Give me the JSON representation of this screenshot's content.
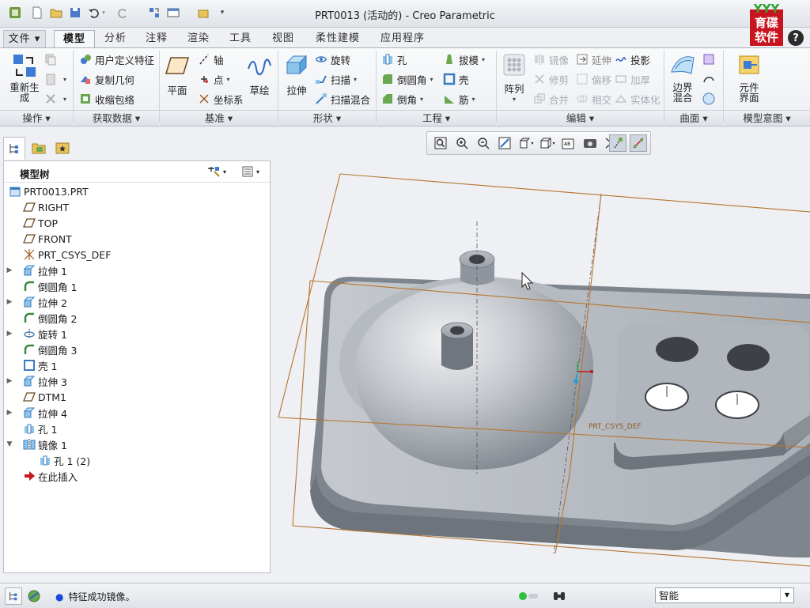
{
  "window": {
    "title": "PRT0013 (活动的) - Creo Parametric",
    "brand_top": "YYY",
    "brand_text": "育碟\n软件"
  },
  "tabs": [
    "文件 ▾",
    "模型",
    "分析",
    "注释",
    "渲染",
    "工具",
    "视图",
    "柔性建模",
    "应用程序"
  ],
  "ribbon": {
    "operations": {
      "regen": "重新生成",
      "group": "操作"
    },
    "get_data": {
      "udf": "用户定义特征",
      "copy_geom": "复制几何",
      "shrinkwrap": "收缩包络",
      "group": "获取数据"
    },
    "datum": {
      "plane": "平面",
      "axis": "轴",
      "point": "点",
      "csys": "坐标系",
      "sketch": "草绘",
      "group": "基准"
    },
    "shapes": {
      "extrude": "拉伸",
      "revolve": "旋转",
      "sweep": "扫描",
      "swept_blend": "扫描混合",
      "group": "形状"
    },
    "engineering": {
      "hole": "孔",
      "round": "倒圆角",
      "chamfer": "倒角",
      "draft": "拔模",
      "shell": "壳",
      "rib": "筋",
      "group": "工程"
    },
    "editing": {
      "pattern": "阵列",
      "mirror": "镜像",
      "trim": "修剪",
      "merge": "合并",
      "extend": "延伸",
      "offset": "偏移",
      "intersect": "相交",
      "project": "投影",
      "thicken": "加厚",
      "solidify": "实体化",
      "group": "编辑"
    },
    "surfaces": {
      "boundary_blend": "边界混合",
      "group": "曲面"
    },
    "model_intent": {
      "component_interface": "元件界面",
      "group": "模型意图"
    }
  },
  "model_tree": {
    "title": "模型树",
    "items": [
      {
        "label": "PRT0013.PRT",
        "icon": "part-icon"
      },
      {
        "label": "RIGHT",
        "icon": "datum-plane-icon"
      },
      {
        "label": "TOP",
        "icon": "datum-plane-icon"
      },
      {
        "label": "FRONT",
        "icon": "datum-plane-icon"
      },
      {
        "label": "PRT_CSYS_DEF",
        "icon": "csys-icon"
      },
      {
        "label": "拉伸 1",
        "icon": "extrude-icon"
      },
      {
        "label": "倒圆角 1",
        "icon": "round-icon"
      },
      {
        "label": "拉伸 2",
        "icon": "extrude-icon"
      },
      {
        "label": "倒圆角 2",
        "icon": "round-icon"
      },
      {
        "label": "旋转 1",
        "icon": "revolve-icon"
      },
      {
        "label": "倒圆角 3",
        "icon": "round-icon"
      },
      {
        "label": "壳 1",
        "icon": "shell-icon"
      },
      {
        "label": "拉伸 3",
        "icon": "extrude-icon"
      },
      {
        "label": "DTM1",
        "icon": "datum-plane-icon"
      },
      {
        "label": "拉伸 4",
        "icon": "extrude-icon"
      },
      {
        "label": "孔 1",
        "icon": "hole-icon"
      },
      {
        "label": "镜像 1",
        "icon": "mirror-icon"
      },
      {
        "label": "孔 1 (2)",
        "icon": "hole-icon"
      },
      {
        "label": "在此插入",
        "icon": "insert-here-icon"
      }
    ]
  },
  "graphics": {
    "csys_label": "PRT_CSYS_DEF"
  },
  "status": {
    "message": "特征成功镜像。",
    "selection_filter": "智能"
  },
  "colors": {
    "accent": "#2b62c4",
    "datum_plane": "#b5752f",
    "model_body": "#9aa0a8",
    "brand": "#c8141e"
  }
}
